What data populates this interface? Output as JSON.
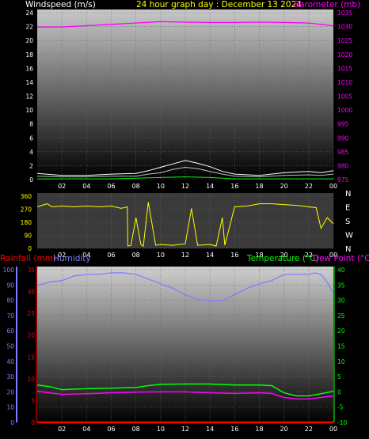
{
  "colors": {
    "background": "#000000",
    "wind": "#ffffff",
    "gust": "#c0c0c0",
    "wind_avg": "#00ff00",
    "barometer": "#ff00ff",
    "direction": "#ffff00",
    "rain": "#ff0000",
    "humidity": "#7f7fff",
    "temperature": "#00ff00",
    "dewpoint": "#ff00ff",
    "title": "#ffff00",
    "ticks": "#ffffff"
  },
  "header": {
    "windspeed_label": "Windspeed (m/s)",
    "title": "24 hour graph day : December 13 2024",
    "barometer_label": "Barometer (mb)"
  },
  "legend2": {
    "rain_label": "Rainfall (mm)",
    "humidity_label": "Humidity",
    "temperature_label": "Temperature (°C)",
    "dewpoint_label": "Dew Point (°C)"
  },
  "chart_data": [
    {
      "type": "line",
      "title": "24 hour graph day : December 13 2024",
      "x_ticks": [
        "02",
        "04",
        "06",
        "08",
        "10",
        "12",
        "14",
        "16",
        "18",
        "20",
        "22",
        "00"
      ],
      "y_left": {
        "label": "Windspeed (m/s)",
        "ticks": [
          "0",
          "2",
          "4",
          "6",
          "8",
          "10",
          "12",
          "14",
          "16",
          "18",
          "20",
          "22",
          "24"
        ],
        "range": [
          0,
          25
        ]
      },
      "y_right": {
        "label": "Barometer (mb)",
        "ticks": [
          "975",
          "980",
          "985",
          "990",
          "995",
          "1000",
          "1005",
          "1010",
          "1015",
          "1020",
          "1025",
          "1030",
          "1035"
        ],
        "range": [
          974,
          1037
        ]
      },
      "series": [
        {
          "axis": "right",
          "x": [
            0,
            2,
            4,
            6,
            8,
            10,
            12,
            14,
            16,
            18,
            20,
            22,
            24
          ],
          "values": [
            1030.5,
            1030.5,
            1031,
            1031.5,
            1032,
            1032.5,
            1032.3,
            1032.2,
            1032.2,
            1032.3,
            1032.2,
            1032,
            1031
          ]
        },
        {
          "axis": "left",
          "x": [
            0,
            2,
            4,
            6,
            8,
            9,
            10,
            11,
            12,
            13,
            14,
            15,
            16,
            18,
            20,
            22,
            23,
            24
          ],
          "values": [
            0.5,
            0.4,
            0.4,
            0.5,
            0.5,
            0.8,
            1.0,
            1.5,
            1.8,
            1.6,
            1.2,
            0.8,
            0.5,
            0.4,
            0.6,
            0.7,
            0.6,
            0.8
          ]
        },
        {
          "axis": "left",
          "x": [
            0,
            2,
            4,
            6,
            8,
            9,
            10,
            11,
            12,
            13,
            14,
            15,
            16,
            18,
            20,
            22,
            23,
            24
          ],
          "values": [
            0.9,
            0.6,
            0.6,
            0.8,
            0.9,
            1.3,
            1.8,
            2.3,
            2.8,
            2.4,
            1.9,
            1.2,
            0.8,
            0.6,
            1.0,
            1.2,
            1.0,
            1.3
          ]
        },
        {
          "axis": "left",
          "x": [
            0,
            6,
            8,
            10,
            12,
            14,
            16,
            24
          ],
          "values": [
            0.1,
            0.1,
            0.2,
            0.3,
            0.4,
            0.3,
            0.1,
            0.1
          ]
        }
      ]
    },
    {
      "type": "line",
      "title": "",
      "x_ticks": [
        "02",
        "04",
        "06",
        "08",
        "10",
        "12",
        "14",
        "16",
        "18",
        "20",
        "22",
        "00"
      ],
      "y_left": {
        "label": "",
        "ticks": [
          "0",
          "90",
          "180",
          "270",
          "360"
        ],
        "range": [
          0,
          360
        ]
      },
      "y_right": {
        "label": "",
        "ticks": [
          "N",
          "W",
          "S",
          "E",
          "N"
        ]
      },
      "series": [
        {
          "axis": "left",
          "x": [
            0,
            0.8,
            1.2,
            2,
            3,
            4,
            5,
            6,
            6.8,
            7.3,
            7.35,
            7.6,
            8,
            8.4,
            8.6,
            9,
            9.6,
            10,
            11,
            12,
            12.5,
            13,
            14,
            14.5,
            15,
            15.2,
            16,
            17,
            18,
            19,
            20,
            21,
            22,
            22.6,
            23,
            23.5,
            24
          ],
          "values": [
            270,
            290,
            270,
            275,
            270,
            275,
            270,
            275,
            260,
            270,
            15,
            20,
            200,
            25,
            15,
            300,
            20,
            25,
            20,
            30,
            260,
            20,
            25,
            15,
            200,
            20,
            270,
            275,
            290,
            290,
            285,
            280,
            270,
            265,
            130,
            200,
            160
          ]
        }
      ]
    },
    {
      "type": "line",
      "title": "",
      "x_ticks": [
        "02",
        "04",
        "06",
        "08",
        "10",
        "12",
        "14",
        "16",
        "18",
        "20",
        "22",
        "00"
      ],
      "y_left": {
        "label": "Humidity",
        "ticks": [
          "0",
          "10",
          "20",
          "30",
          "40",
          "50",
          "60",
          "70",
          "80",
          "90",
          "100"
        ],
        "range": [
          0,
          100
        ]
      },
      "y_rain": {
        "label": "Rainfall (mm)",
        "ticks": [
          "0",
          "5",
          "10",
          "15",
          "20",
          "25",
          "30",
          "35"
        ],
        "range": [
          0,
          35
        ]
      },
      "y_right": {
        "label": "Temperature (°C)",
        "ticks": [
          "-10",
          "-5",
          "0",
          "5",
          "10",
          "15",
          "20",
          "25",
          "30",
          "35",
          "40"
        ],
        "range": [
          -10,
          40
        ]
      },
      "series": [
        {
          "name": "Humidity",
          "axis": "left",
          "x": [
            0,
            1,
            2,
            3,
            4,
            5,
            6,
            7,
            8,
            9,
            10,
            11,
            12,
            13,
            14,
            15,
            16,
            17,
            18,
            19,
            20,
            21,
            22,
            22.5,
            23,
            23.5,
            24
          ],
          "values": [
            88,
            90,
            91,
            94,
            95,
            95,
            96,
            96,
            95,
            92,
            89,
            86,
            82,
            79,
            78,
            78,
            82,
            86,
            89,
            91,
            95,
            95,
            95,
            96,
            95,
            90,
            83
          ]
        },
        {
          "name": "Temperature (°C)",
          "axis": "right",
          "x": [
            0,
            1,
            2,
            4,
            6,
            8,
            9,
            10,
            12,
            14,
            16,
            18,
            19,
            20,
            21,
            22,
            23,
            24
          ],
          "values": [
            2,
            1.5,
            0.5,
            0.8,
            1,
            1.2,
            1.8,
            2.2,
            2.3,
            2.3,
            2,
            2,
            1.8,
            -0.5,
            -1.5,
            -1.5,
            -0.8,
            0
          ]
        },
        {
          "name": "Dew Point (°C)",
          "axis": "right",
          "x": [
            0,
            1,
            2,
            4,
            6,
            8,
            10,
            12,
            14,
            16,
            18,
            19,
            20,
            21,
            22,
            23,
            24
          ],
          "values": [
            0,
            -0.5,
            -1,
            -0.8,
            -0.5,
            -0.3,
            -0.2,
            -0.2,
            -0.5,
            -0.7,
            -0.5,
            -0.7,
            -2,
            -2.5,
            -2.5,
            -2,
            -1.5
          ]
        },
        {
          "name": "Rainfall (mm)",
          "axis": "rain",
          "x": [
            0,
            24
          ],
          "values": [
            0,
            0
          ]
        }
      ]
    }
  ]
}
